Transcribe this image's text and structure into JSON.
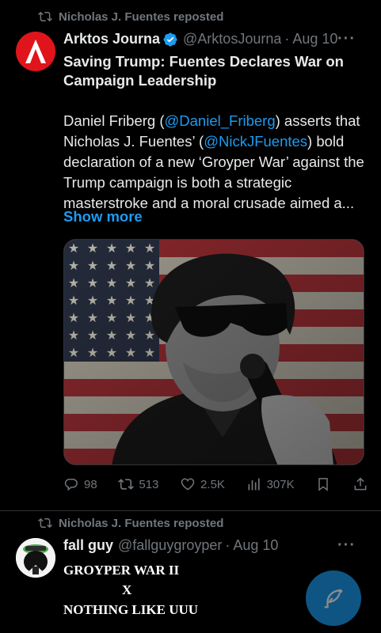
{
  "tweets": [
    {
      "repost_text": "Nicholas J. Fuentes reposted",
      "author_name": "Arktos Journa",
      "handle": "@ArktosJourna",
      "date": "Aug 10",
      "title": "Saving Trump: Fuentes Declares War on Campaign Leadership",
      "body_parts": {
        "p1": "Daniel Friberg (",
        "mention1": "@Daniel_Friberg",
        "p2": ") asserts that Nicholas J. Fuentes’ (",
        "mention2": "@NickJFuentes",
        "p3": ") bold declaration of a new ‘Groyper War’ against the Trump campaign is both a strategic masterstroke and a moral crusade aimed a..."
      },
      "show_more": "Show more",
      "actions": {
        "replies": "98",
        "reposts": "513",
        "likes": "2.5K",
        "views": "307K"
      }
    },
    {
      "repost_text": "Nicholas J. Fuentes reposted",
      "author_name": "fall guy",
      "handle": "@fallguygroyper",
      "date": "Aug 10",
      "lines": [
        "GROYPER WAR II",
        "X",
        "NOTHING LIKE UUU"
      ]
    }
  ],
  "colors": {
    "accent": "#1d9bf0",
    "muted": "#71767b",
    "brand_red": "#e0141b"
  },
  "icons": [
    "repost-icon",
    "verified-badge-icon",
    "more-icon",
    "reply-icon",
    "like-icon",
    "views-icon",
    "bookmark-icon",
    "share-icon",
    "compose-icon"
  ]
}
